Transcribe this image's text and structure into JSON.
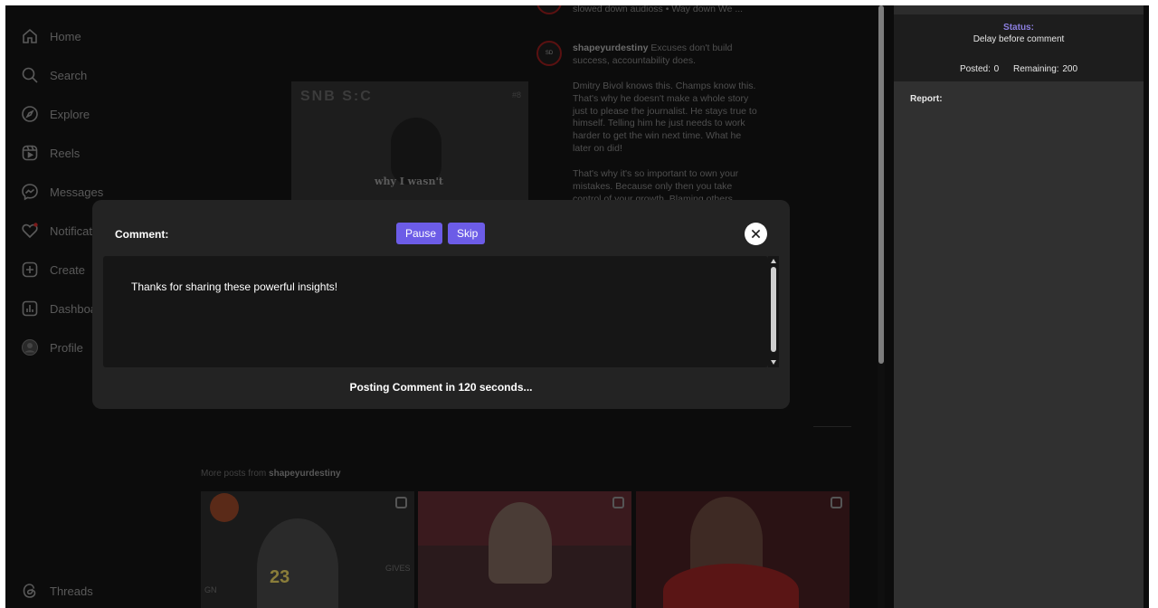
{
  "nav": {
    "items": [
      {
        "label": "Home",
        "icon": "home-icon"
      },
      {
        "label": "Search",
        "icon": "search-icon"
      },
      {
        "label": "Explore",
        "icon": "compass-icon"
      },
      {
        "label": "Reels",
        "icon": "reels-icon"
      },
      {
        "label": "Messages",
        "icon": "messenger-icon"
      },
      {
        "label": "Notificat",
        "icon": "heart-icon"
      },
      {
        "label": "Create",
        "icon": "plus-square-icon"
      },
      {
        "label": "Dashboa",
        "icon": "chart-icon"
      },
      {
        "label": "Profile",
        "icon": "avatar-icon"
      }
    ],
    "threads": {
      "label": "Threads",
      "icon": "threads-icon"
    }
  },
  "post": {
    "image_brand": "SNB S:C",
    "image_brand_right": "#8",
    "image_caption": "why I wasn't",
    "top_comment": "slowed down audioss • Way down We ...",
    "author": "shapeyurdestiny",
    "avatar_text": "SD",
    "caption_first": "Excuses don't build success, accountability does.",
    "caption_para2": "Dmitry Bivol knows this. Champs know this. That's why he doesn't make a whole story just to please the journalist. He stays true to himself. Telling him he just needs to work harder to get the win next time. What he later on did!",
    "caption_para3": "That's why it's so important to own your mistakes. Because only then you take control of your growth. Blaming others...",
    "more_posts_prefix": "More posts from",
    "more_posts_author": "shapeyurdestiny",
    "thumb1_text": "23",
    "thumb1_side": "GIVES",
    "thumb1_sub": "GN"
  },
  "panel": {
    "status_label": "Status:",
    "status_value": "Delay before comment",
    "posted_label": "Posted: 0",
    "remaining_label": "Remaining: 200",
    "report_label": "Report:"
  },
  "modal": {
    "title": "Comment:",
    "pause_label": "Pause",
    "skip_label": "Skip",
    "comment_text": "Thanks for sharing these powerful insights!",
    "countdown_text": "Posting Comment in 120 seconds..."
  },
  "colors": {
    "accent": "#6c5ce7",
    "status_label": "#8c7fe0",
    "modal_bg": "#232323",
    "page_bg": "#0c0c0c"
  }
}
